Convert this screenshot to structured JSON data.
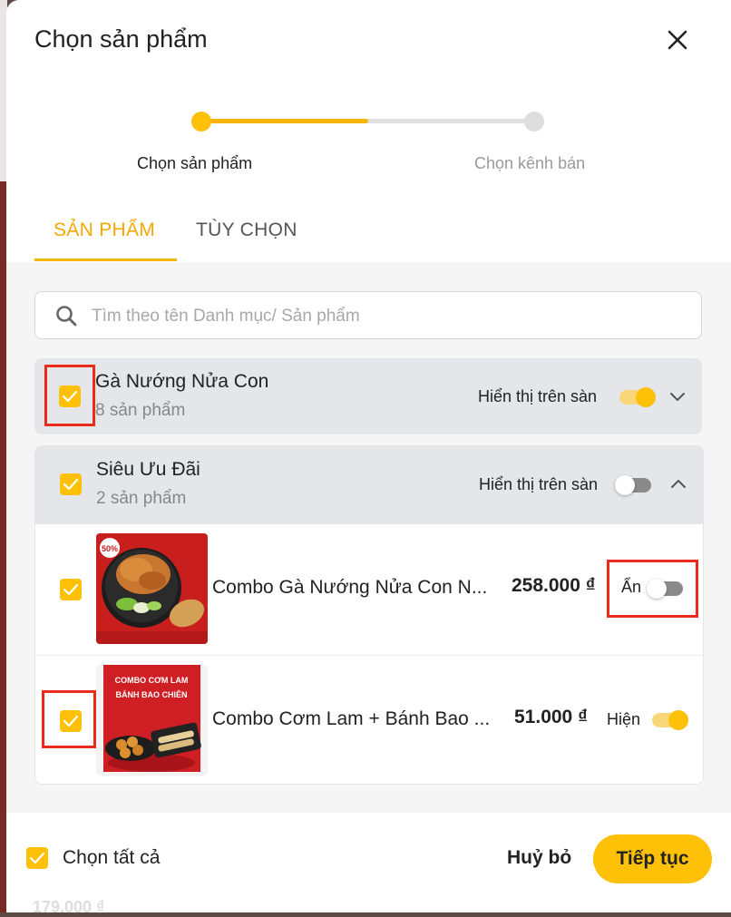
{
  "dialog": {
    "title": "Chọn sản phẩm"
  },
  "stepper": {
    "steps": [
      {
        "label": "Chọn sản phẩm"
      },
      {
        "label": "Chọn kênh bán"
      }
    ],
    "progress": 0.5
  },
  "tabs": [
    {
      "label": "SẢN PHẨM"
    },
    {
      "label": "TÙY CHỌN"
    }
  ],
  "search": {
    "placeholder": "Tìm theo tên Danh mục/ Sản phẩm",
    "value": ""
  },
  "groups": [
    {
      "title": "Gà Nướng Nửa Con",
      "subtitle": "8 sản phẩm",
      "show_label": "Hiển thị trên sàn",
      "show_on": true,
      "checked": true,
      "expanded": false
    },
    {
      "title": "Siêu Ưu Đãi",
      "subtitle": "2 sản phẩm",
      "show_label": "Hiển thị trên sàn",
      "show_on": false,
      "checked": true,
      "expanded": true,
      "items": [
        {
          "name": "Combo Gà Nướng Nửa Con N...",
          "price": "258.000 ₫",
          "visibility_label": "Ẩn",
          "visible": false,
          "checked": true,
          "badge": "50%"
        },
        {
          "name": "Combo Cơm Lam + Bánh Bao ...",
          "price": "51.000 ₫",
          "visibility_label": "Hiện",
          "visible": true,
          "checked": true,
          "image_text": [
            "COMBO CƠM LAM",
            "BÁNH BAO CHIÊN"
          ]
        }
      ]
    }
  ],
  "footer": {
    "select_all": "Chọn tất cả",
    "cancel": "Huỷ bỏ",
    "next": "Tiếp tục"
  },
  "background_text": "179.000 ₫",
  "colors": {
    "accent": "#ffc107",
    "highlight": "#ea2a1b"
  }
}
